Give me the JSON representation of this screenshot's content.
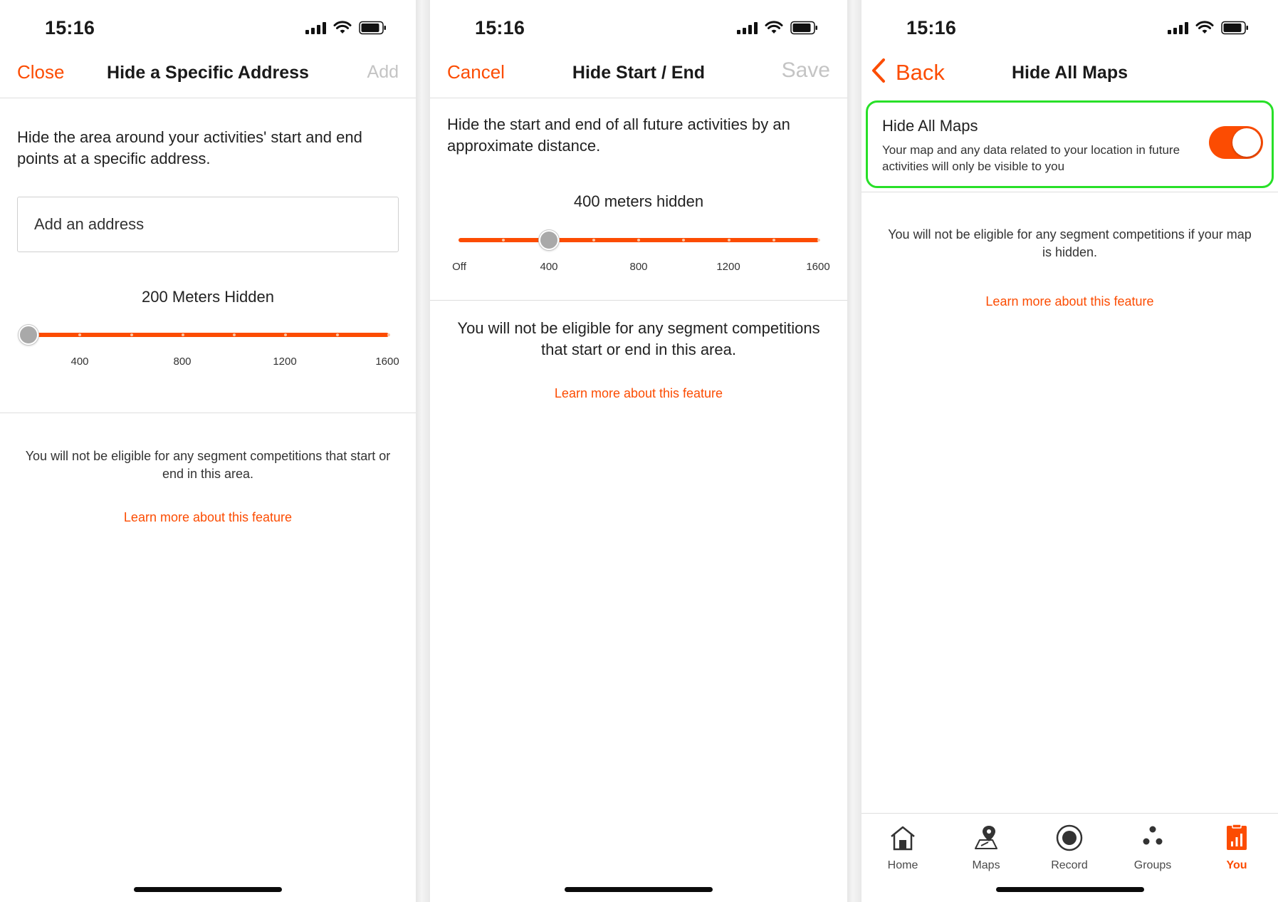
{
  "colors": {
    "accent": "#fc4c02",
    "disabled": "#c4c4c4",
    "highlight": "#28e028"
  },
  "panel1": {
    "time": "15:16",
    "nav": {
      "left": "Close",
      "title": "Hide a Specific Address",
      "right": "Add"
    },
    "description": "Hide the area around your activities' start and end points at a specific address.",
    "address_input": {
      "placeholder": "Add an address"
    },
    "slider": {
      "label": "200 Meters Hidden",
      "value": 200,
      "ticks": [
        "400",
        "800",
        "1200",
        "1600"
      ]
    },
    "note": "You will not be eligible for any segment competitions that start or end in this area.",
    "link": "Learn more about this feature"
  },
  "panel2": {
    "time": "15:16",
    "nav": {
      "left": "Cancel",
      "title": "Hide Start / End",
      "right": "Save"
    },
    "description": "Hide the start and end of all future activities by an approximate distance.",
    "slider": {
      "label": "400 meters hidden",
      "value": 400,
      "ticks": [
        "Off",
        "400",
        "800",
        "1200",
        "1600"
      ]
    },
    "note": "You will not be eligible for any segment competitions that start or end in this area.",
    "link": "Learn more about this feature"
  },
  "panel3": {
    "time": "15:16",
    "nav": {
      "left": "Back",
      "title": "Hide All Maps"
    },
    "setting": {
      "title": "Hide All Maps",
      "description": "Your map and any data related to your location in future activities will only be visible to you",
      "enabled": true
    },
    "note": "You will not be eligible for any segment competitions if your map is hidden.",
    "link": "Learn more about this feature",
    "tabs": [
      {
        "label": "Home",
        "icon": "home-icon",
        "active": false
      },
      {
        "label": "Maps",
        "icon": "map-pin-icon",
        "active": false
      },
      {
        "label": "Record",
        "icon": "record-icon",
        "active": false
      },
      {
        "label": "Groups",
        "icon": "groups-icon",
        "active": false
      },
      {
        "label": "You",
        "icon": "profile-chart-icon",
        "active": true
      }
    ]
  }
}
